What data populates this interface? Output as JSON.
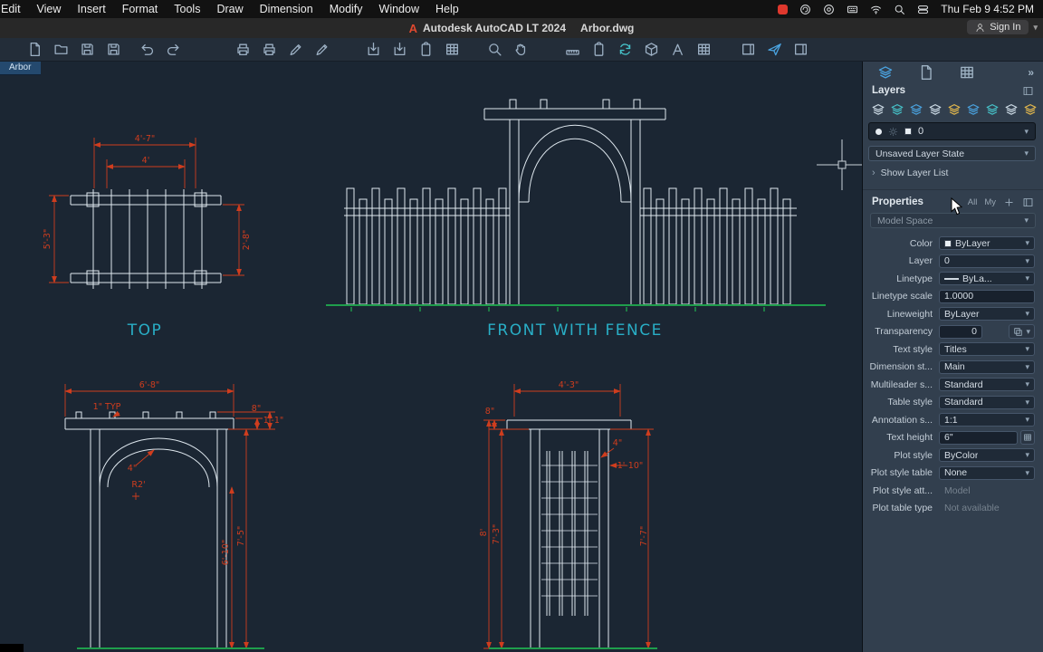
{
  "menubar": {
    "items": [
      "Edit",
      "View",
      "Insert",
      "Format",
      "Tools",
      "Draw",
      "Dimension",
      "Modify",
      "Window",
      "Help"
    ],
    "status_icon_names": [
      "record-icon",
      "assistant-icon",
      "app-circle-icon",
      "keyboard-icon",
      "wifi-icon",
      "search-icon",
      "control-center-icon"
    ],
    "clock": "Thu Feb 9  4:52 PM"
  },
  "titlebar": {
    "app_title": "Autodesk AutoCAD LT 2024",
    "doc_title": "Arbor.dwg",
    "sign_in_label": "Sign In"
  },
  "doc_tab": {
    "label": "Arbor"
  },
  "toolbar": {
    "icon_names": [
      "new-file",
      "open-file",
      "save",
      "save-as",
      "undo",
      "redo",
      "print",
      "print-plus",
      "page-setup",
      "plot-settings",
      "export",
      "import",
      "attach",
      "sheet-manager",
      "zoom-window",
      "pan",
      "measure",
      "match-properties",
      "refresh",
      "insert-block",
      "text",
      "table",
      "content-panel",
      "share",
      "layout-panel"
    ]
  },
  "drawing": {
    "labels": {
      "top_view": "TOP",
      "front_view": "FRONT WITH FENCE"
    },
    "top_view_dims": {
      "width": "4'-7\"",
      "inner_width": "4'",
      "left_height": "5'-3\"",
      "right_height": "2'-8\""
    },
    "arch_view_dims": {
      "width": "6'-8\"",
      "typ": "1\" TYP",
      "overhang": "8\"",
      "end": "1'-1\"",
      "thickness": "4\"",
      "radius": "R2'",
      "height": "7'-5\"",
      "opening": "6'-10\""
    },
    "side_view_dims": {
      "width": "4'-3\"",
      "overhang": "8\"",
      "slat": "4\"",
      "panel": "1'-10\"",
      "left_height": "7'-3\"",
      "total_height": "8'",
      "right_height": "7'-7\""
    }
  },
  "layers_panel": {
    "title": "Layers",
    "tool_icon_names": [
      "layer-properties-icon",
      "new-layer-icon",
      "layer-state-icon",
      "layer-isolate-icon",
      "layer-freeze-icon",
      "layer-off-icon",
      "layer-lock-icon",
      "layer-color-icon",
      "layer-merge-icon"
    ],
    "current_layer": "0",
    "layer_state": "Unsaved Layer State",
    "show_layer_list": "Show Layer List"
  },
  "properties_panel": {
    "title": "Properties",
    "filter_all": "All",
    "filter_my": "My",
    "space": "Model Space",
    "rows": [
      {
        "label": "Color",
        "value": "ByLayer"
      },
      {
        "label": "Layer",
        "value": "0"
      },
      {
        "label": "Linetype",
        "value": "ByLa..."
      },
      {
        "label": "Linetype scale",
        "value": "1.0000"
      },
      {
        "label": "Lineweight",
        "value": "ByLayer"
      },
      {
        "label": "Transparency",
        "value": "0"
      },
      {
        "label": "Text style",
        "value": "Titles"
      },
      {
        "label": "Dimension st...",
        "value": "Main"
      },
      {
        "label": "Multileader s...",
        "value": "Standard"
      },
      {
        "label": "Table style",
        "value": "Standard"
      },
      {
        "label": "Annotation s...",
        "value": "1:1"
      },
      {
        "label": "Text height",
        "value": "6\""
      },
      {
        "label": "Plot style",
        "value": "ByColor"
      },
      {
        "label": "Plot style table",
        "value": "None"
      },
      {
        "label": "Plot style att...",
        "value": "Model"
      },
      {
        "label": "Plot table type",
        "value": "Not available"
      }
    ]
  },
  "colors": {
    "accent_blue": "#4aa3e0",
    "dimension_red": "#cf3d1e",
    "label_cyan": "#29aec6",
    "ground_green": "#1f9e4c",
    "drawing_line": "#dfe8ef"
  }
}
